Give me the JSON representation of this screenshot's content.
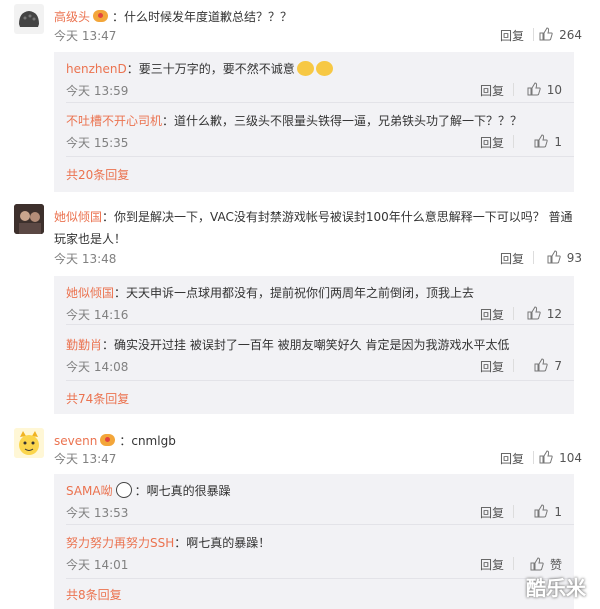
{
  "comments": [
    {
      "author": "高级头",
      "text": "：什么时候发年度道歉总结？？？",
      "time": "今天 13:47",
      "reply_label": "回复",
      "likes": "264",
      "replies": [
        {
          "author": "henzhenD",
          "text": "：要三十万字的，要不然不诚意",
          "time": "今天 13:59",
          "reply_label": "回复",
          "likes": "10"
        },
        {
          "author": "不吐槽不开心司机",
          "text": "：道什么歉，三级头不限量头铁得一逼，兄弟铁头功了解一下？？？",
          "time": "今天 15:35",
          "reply_label": "回复",
          "likes": "1"
        }
      ],
      "more": "共20条回复"
    },
    {
      "author": "她似倾国",
      "text_line1": "：你到是解决一下，VAC没有封禁游戏帐号被误封100年什么意思解释一下可以吗？ 普通",
      "text_line2": "玩家也是人！",
      "time": "今天 13:48",
      "reply_label": "回复",
      "likes": "93",
      "replies": [
        {
          "author": "她似倾国",
          "text": "：天天申诉一点球用都没有，提前祝你们两周年之前倒闭，顶我上去",
          "time": "今天 14:16",
          "reply_label": "回复",
          "likes": "12"
        },
        {
          "author": "勤勤肖",
          "text": "：确实没开过挂 被误封了一百年 被朋友嘲笑好久 肯定是因为我游戏水平太低",
          "time": "今天 14:08",
          "reply_label": "回复",
          "likes": "7"
        }
      ],
      "more": "共74条回复"
    },
    {
      "author": "sevenn",
      "text": "：cnmlgb",
      "time": "今天 13:47",
      "reply_label": "回复",
      "likes": "104",
      "replies": [
        {
          "author": "SAMA呦",
          "text": "：啊七真的很暴躁",
          "time": "今天 13:53",
          "reply_label": "回复",
          "likes": "1"
        },
        {
          "author": "努力努力再努力SSH",
          "text": "：啊七真的暴躁！",
          "time": "今天 14:01",
          "reply_label": "回复",
          "likes": "赞"
        }
      ],
      "more": "共8条回复"
    }
  ],
  "watermark": "酷乐米",
  "colors": {
    "name": "#eb7350",
    "sub_bg": "#f2f2f5",
    "meta": "#808080"
  },
  "icons": {
    "like": "thumbs-up-icon",
    "vip": "vip-badge-icon",
    "emoji": "sweat-smile-emoji-icon",
    "panda": "panda-icon"
  }
}
